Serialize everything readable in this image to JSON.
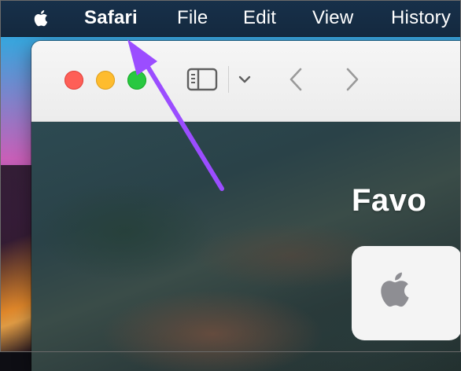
{
  "menubar": {
    "apple_icon": "apple-logo-icon",
    "items": [
      {
        "label": "Safari"
      },
      {
        "label": "File"
      },
      {
        "label": "Edit"
      },
      {
        "label": "View"
      },
      {
        "label": "History"
      }
    ]
  },
  "window": {
    "traffic_lights": [
      "close",
      "minimize",
      "zoom"
    ],
    "toolbar": {
      "icons": [
        "sidebar-icon",
        "chevron-down-icon",
        "back-arrow-icon",
        "forward-arrow-icon"
      ]
    },
    "start_page": {
      "section_title": "Favo",
      "favorite_icon": "apple-logo-icon"
    }
  },
  "colors": {
    "annotation_arrow": "#9b4dff",
    "menubar": "#15293f",
    "close": "#fe5f57",
    "minimize": "#febc2e",
    "zoom": "#28c840"
  }
}
